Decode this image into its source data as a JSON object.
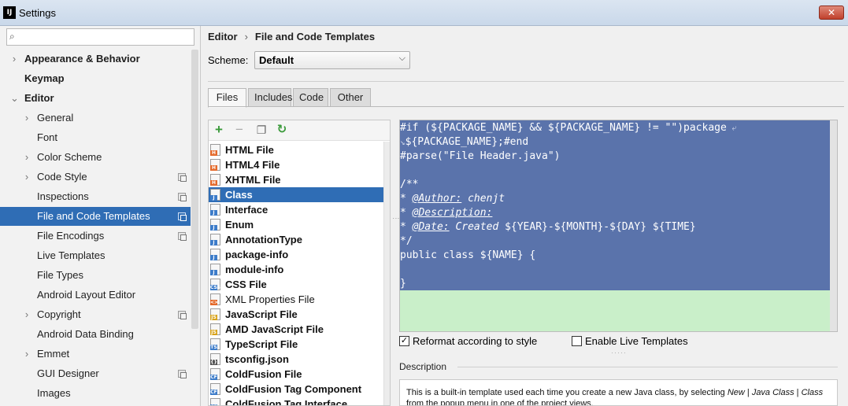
{
  "window": {
    "title": "Settings",
    "app_icon": "IJ",
    "close_label": "✕"
  },
  "search": {
    "placeholder": "",
    "value": ""
  },
  "sidebar": {
    "items": [
      {
        "label": "Appearance & Behavior",
        "arrow": "›",
        "bold": true
      },
      {
        "label": "Keymap",
        "arrow": "",
        "bold": true
      },
      {
        "label": "Editor",
        "arrow": "⌄",
        "bold": true
      },
      {
        "label": "General",
        "arrow": "›"
      },
      {
        "label": "Font",
        "arrow": ""
      },
      {
        "label": "Color Scheme",
        "arrow": "›"
      },
      {
        "label": "Code Style",
        "arrow": "›",
        "copy": true
      },
      {
        "label": "Inspections",
        "arrow": "",
        "copy": true
      },
      {
        "label": "File and Code Templates",
        "arrow": "",
        "copy": true,
        "selected": true
      },
      {
        "label": "File Encodings",
        "arrow": "",
        "copy": true
      },
      {
        "label": "Live Templates",
        "arrow": ""
      },
      {
        "label": "File Types",
        "arrow": ""
      },
      {
        "label": "Android Layout Editor",
        "arrow": ""
      },
      {
        "label": "Copyright",
        "arrow": "›",
        "copy": true
      },
      {
        "label": "Android Data Binding",
        "arrow": ""
      },
      {
        "label": "Emmet",
        "arrow": "›"
      },
      {
        "label": "GUI Designer",
        "arrow": "",
        "copy": true
      },
      {
        "label": "Images",
        "arrow": ""
      }
    ]
  },
  "breadcrumb": {
    "root": "Editor",
    "separator": "›",
    "current": "File and Code Templates"
  },
  "scheme": {
    "label": "Scheme:",
    "value": "Default",
    "chevron": "⌵"
  },
  "tabs": [
    {
      "label": "Files",
      "active": true
    },
    {
      "label": "Includes"
    },
    {
      "label": "Code"
    },
    {
      "label": "Other"
    }
  ],
  "toolbar": {
    "add": "+",
    "remove": "−",
    "copy": "❐",
    "reset": "↻"
  },
  "templates": [
    {
      "name": "HTML File",
      "bold": true,
      "tag": "H",
      "color": "#e4692a"
    },
    {
      "name": "HTML4 File",
      "bold": true,
      "tag": "H",
      "color": "#e4692a"
    },
    {
      "name": "XHTML File",
      "bold": true,
      "tag": "H",
      "color": "#e4692a"
    },
    {
      "name": "Class",
      "bold": true,
      "tag": "J",
      "color": "#3d7cc9",
      "selected": true
    },
    {
      "name": "Interface",
      "bold": true,
      "tag": "J",
      "color": "#3d7cc9"
    },
    {
      "name": "Enum",
      "bold": true,
      "tag": "J",
      "color": "#3d7cc9"
    },
    {
      "name": "AnnotationType",
      "bold": true,
      "tag": "J",
      "color": "#3d7cc9"
    },
    {
      "name": "package-info",
      "bold": true,
      "tag": "J",
      "color": "#3d7cc9"
    },
    {
      "name": "module-info",
      "bold": true,
      "tag": "J",
      "color": "#3d7cc9"
    },
    {
      "name": "CSS File",
      "bold": true,
      "tag": "CSS",
      "color": "#3d7cc9"
    },
    {
      "name": "XML Properties File",
      "bold": false,
      "tag": "<>",
      "color": "#e4692a"
    },
    {
      "name": "JavaScript File",
      "bold": true,
      "tag": "JS",
      "color": "#d7a21a"
    },
    {
      "name": "AMD JavaScript File",
      "bold": true,
      "tag": "JS",
      "color": "#d7a21a"
    },
    {
      "name": "TypeScript File",
      "bold": true,
      "tag": "TS",
      "color": "#3d7cc9"
    },
    {
      "name": "tsconfig.json",
      "bold": true,
      "tag": "{}",
      "color": "#555555"
    },
    {
      "name": "ColdFusion File",
      "bold": true,
      "tag": "CF",
      "color": "#3d7cc9"
    },
    {
      "name": "ColdFusion Tag Component",
      "bold": true,
      "tag": "CF",
      "color": "#3d7cc9"
    },
    {
      "name": "ColdFusion Tag Interface",
      "bold": true,
      "tag": "CF",
      "color": "#3d7cc9"
    }
  ],
  "editor": {
    "lines": [
      "#if (${PACKAGE_NAME} && ${PACKAGE_NAME} != \"\")package",
      "${PACKAGE_NAME};#end",
      "#parse(\"File Header.java\")",
      "",
      "/**",
      "* @Author: chenjt",
      "* @Description:",
      "* @Date: Created ${YEAR}-${MONTH}-${DAY} ${TIME}",
      "*/",
      "public class ${NAME} {",
      "",
      "}"
    ],
    "wrap_mark": "⤶"
  },
  "options": {
    "reformat": {
      "label": "Reformat according to style",
      "checked": true
    },
    "live_templates": {
      "label": "Enable Live Templates",
      "checked": false
    }
  },
  "description": {
    "label": "Description",
    "text_1": "This is a built-in template used each time you create a new Java class, by selecting ",
    "text_new": "New",
    "text_2": " | ",
    "text_java_class": "Java Class",
    "text_3": " | ",
    "text_class": "Class",
    "text_4": " from the popup menu in one of the project views."
  },
  "colors": {
    "selection": "#2f6db5",
    "editor_selected_bg": "#5a73ab",
    "editor_bg": "#c9efc9"
  }
}
